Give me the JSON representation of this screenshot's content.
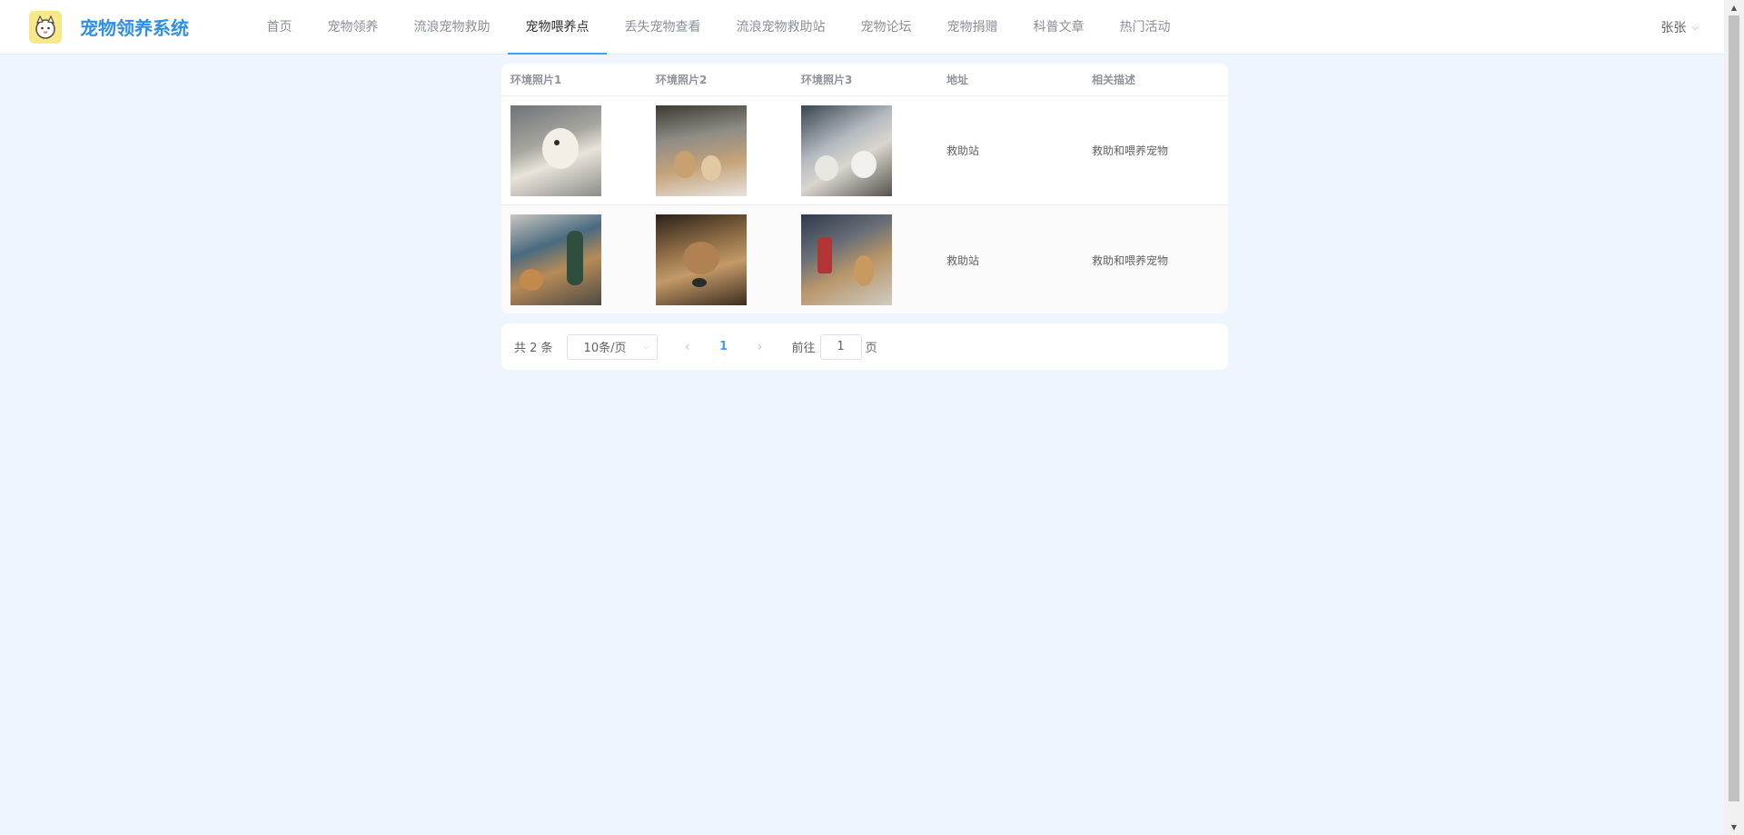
{
  "app": {
    "title": "宠物领养系统"
  },
  "nav": {
    "items": [
      "首页",
      "宠物领养",
      "流浪宠物救助",
      "宠物喂养点",
      "丢失宠物查看",
      "流浪宠物救助站",
      "宠物论坛",
      "宠物捐赠",
      "科普文章",
      "热门活动"
    ],
    "active_index": 3
  },
  "user": {
    "name": "张张"
  },
  "table": {
    "headers": [
      "环境照片1",
      "环境照片2",
      "环境照片3",
      "地址",
      "相关描述"
    ],
    "rows": [
      {
        "address": "救助站",
        "description": "救助和喂养宠物"
      },
      {
        "address": "救助站",
        "description": "救助和喂养宠物"
      }
    ]
  },
  "pagination": {
    "total_text": "共 2 条",
    "page_size": "10条/页",
    "current_page": "1",
    "goto_label": "前往",
    "goto_value": "1",
    "page_suffix": "页"
  },
  "colors": {
    "brand": "#2f8fe8",
    "active_underline": "#409eff",
    "background": "#eef5fc"
  }
}
